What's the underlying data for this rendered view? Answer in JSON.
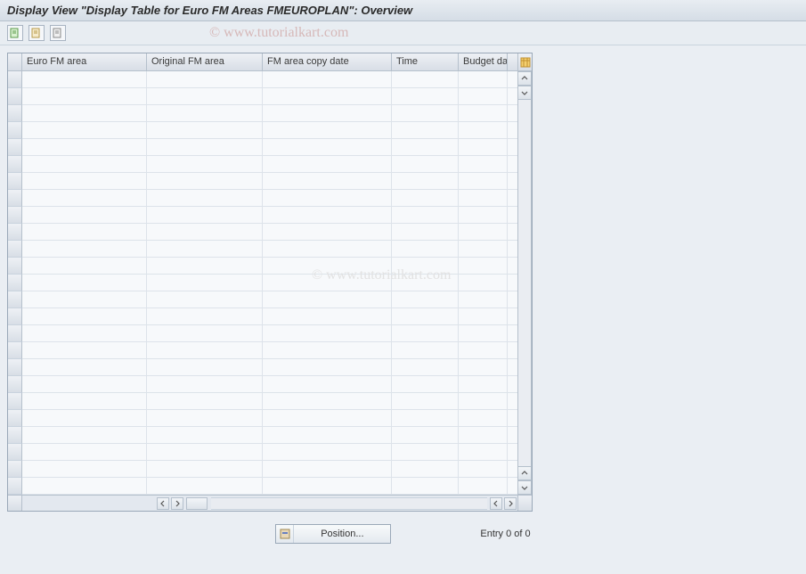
{
  "title": "Display View \"Display Table for Euro FM Areas FMEUROPLAN\": Overview",
  "watermark": "© www.tutorialkart.com",
  "toolbar": {
    "btn1_name": "expand-all-icon",
    "btn2_name": "select-all-icon",
    "btn3_name": "deselect-all-icon"
  },
  "columns": [
    {
      "label": "Euro FM area"
    },
    {
      "label": "Original FM area"
    },
    {
      "label": "FM area copy date"
    },
    {
      "label": "Time"
    },
    {
      "label": "Budget da"
    }
  ],
  "row_count": 25,
  "footer": {
    "position_label": "Position...",
    "entry_text": "Entry 0 of 0"
  }
}
